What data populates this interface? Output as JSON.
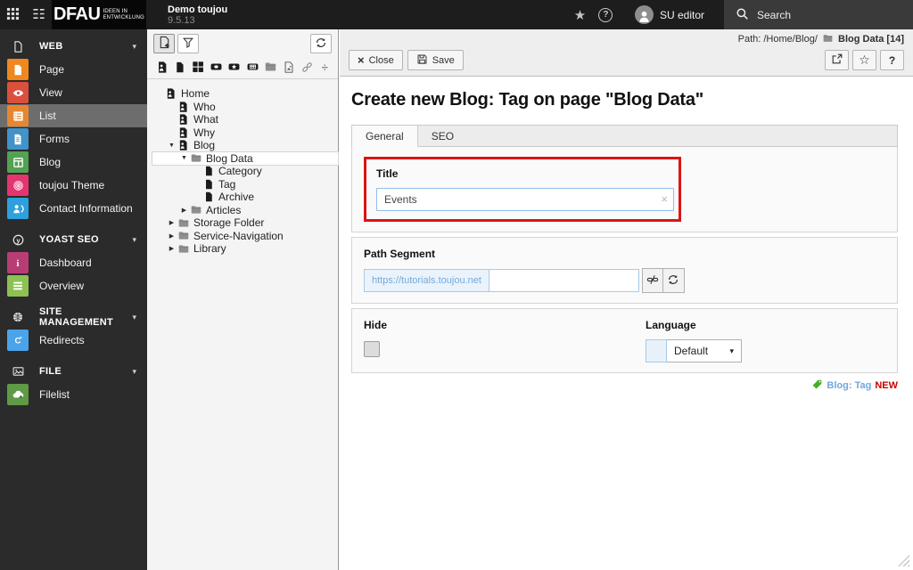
{
  "topbar": {
    "logo_text": "DFAU",
    "logo_tagline_line1": "IDEEN IN",
    "logo_tagline_line2": "ENTWICKLUNG",
    "site_name": "Demo toujou",
    "version": "9.5.13",
    "user_name": "SU editor",
    "search_label": "Search",
    "help_glyph": "?"
  },
  "sidebar": {
    "entries": [
      {
        "type": "header",
        "label": "WEB",
        "icon": "page-outline-icon"
      },
      {
        "type": "module",
        "label": "Page",
        "icon": "document-icon",
        "color": "#f0871f"
      },
      {
        "type": "module",
        "label": "View",
        "icon": "eye-icon",
        "color": "#dc4f3d"
      },
      {
        "type": "module",
        "label": "List",
        "icon": "list-icon",
        "color": "#e8862f",
        "active": true
      },
      {
        "type": "module",
        "label": "Forms",
        "icon": "form-icon",
        "color": "#4193c9"
      },
      {
        "type": "module",
        "label": "Blog",
        "icon": "blog-grid-icon",
        "color": "#53a153"
      },
      {
        "type": "module",
        "label": "toujou Theme",
        "icon": "fingerprint-icon",
        "color": "#e5356f"
      },
      {
        "type": "module",
        "label": "Contact Information",
        "icon": "contact-icon",
        "color": "#2ea0dd"
      },
      {
        "type": "header",
        "label": "YOAST SEO",
        "icon": "yoast-icon"
      },
      {
        "type": "module",
        "label": "Dashboard",
        "icon": "info-icon",
        "color": "#b93d75"
      },
      {
        "type": "module",
        "label": "Overview",
        "icon": "rows-icon",
        "color": "#8dc153"
      },
      {
        "type": "header",
        "label": "SITE MANAGEMENT",
        "icon": "globe-icon"
      },
      {
        "type": "module",
        "label": "Redirects",
        "icon": "redirect-icon",
        "color": "#4ba3ea"
      },
      {
        "type": "header",
        "label": "FILE",
        "icon": "image-icon"
      },
      {
        "type": "module",
        "label": "Filelist",
        "icon": "cloud-icon",
        "color": "#5f9a46"
      }
    ]
  },
  "tree": {
    "nodes": [
      {
        "label": "Home",
        "icon": "page"
      },
      {
        "label": "Who",
        "icon": "page"
      },
      {
        "label": "What",
        "icon": "page"
      },
      {
        "label": "Why",
        "icon": "page"
      },
      {
        "label": "Blog",
        "icon": "page",
        "expanded": true
      },
      {
        "label": "Blog Data",
        "icon": "folder",
        "expanded": true,
        "selected": true
      },
      {
        "label": "Category",
        "icon": "doc"
      },
      {
        "label": "Tag",
        "icon": "doc"
      },
      {
        "label": "Archive",
        "icon": "doc"
      },
      {
        "label": "Articles",
        "icon": "folder",
        "collapsed": true
      },
      {
        "label": "Storage Folder",
        "icon": "folder",
        "collapsed": true
      },
      {
        "label": "Service-Navigation",
        "icon": "folder",
        "collapsed": true
      },
      {
        "label": "Library",
        "icon": "folder",
        "collapsed": true
      }
    ],
    "arrows": {
      "expanded": "▼",
      "collapsed": "▶"
    }
  },
  "docheader": {
    "path_label": "Path: /Home/Blog/",
    "current_page": "Blog Data [14]",
    "close_label": "Close",
    "save_label": "Save",
    "help_label": "?"
  },
  "main": {
    "heading": "Create new Blog: Tag on page \"Blog Data\"",
    "tabs": [
      {
        "label": "General",
        "active": true
      },
      {
        "label": "SEO",
        "active": false
      }
    ],
    "title_field": {
      "label": "Title",
      "value": "Events",
      "clear_glyph": "×"
    },
    "path_field": {
      "label": "Path Segment",
      "prefix": "https://tutorials.toujou.net",
      "value": ""
    },
    "hide_field": {
      "label": "Hide",
      "checked": false
    },
    "language_field": {
      "label": "Language",
      "value": "Default",
      "caret_glyph": "▾"
    },
    "record_badge": {
      "type_label": "Blog: Tag",
      "state": "NEW"
    }
  },
  "colors": {
    "topbar_bg": "#1d1d1d",
    "sidebar_bg": "#2b2b2b",
    "sidebar_active_bg": "#6d6d6d",
    "highlight_red": "#dd1414",
    "input_focus_blue": "#8fbfec",
    "slug_prefix_blue": "#74a9da",
    "record_link_blue": "#6fa7db",
    "new_badge_red": "#cc0000",
    "tag_icon_green": "#45ad27"
  }
}
